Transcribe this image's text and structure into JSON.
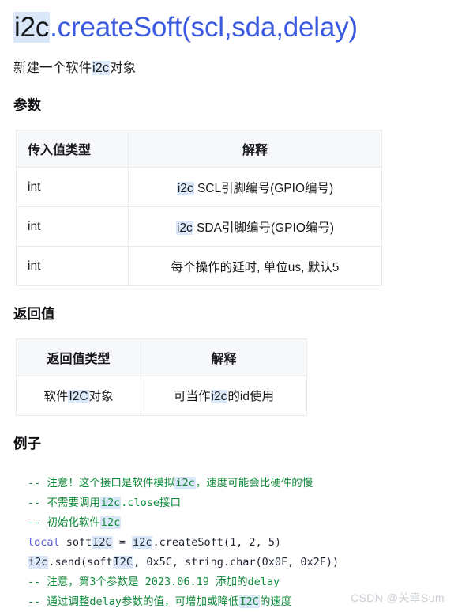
{
  "colors": {
    "title_blue": "#3b5ae0",
    "highlight_bg": "#d9e7f8",
    "table_header_bg": "#f7f8fa",
    "table_border": "#e8eaed",
    "code_comment_green": "#108a3a",
    "code_keyword_purple": "#5b5bd6",
    "watermark_gray": "#c9cdd2",
    "body_text": "#17181a"
  },
  "title": {
    "highlight_token": "i2c",
    "rest": ".createSoft(scl,sda,delay)"
  },
  "subtitle": {
    "before": "新建一个软件",
    "highlight_token": "i2c",
    "after": "对象"
  },
  "sections": {
    "params_heading": "参数",
    "return_heading": "返回值",
    "example_heading": "例子"
  },
  "params_table": {
    "headers": [
      "传入值类型",
      "解释"
    ],
    "rows": [
      {
        "type": "int",
        "desc_before": "",
        "desc_highlight": "i2c",
        "desc_after": " SCL引脚编号(GPIO编号)"
      },
      {
        "type": "int",
        "desc_before": "",
        "desc_highlight": "i2c",
        "desc_after": " SDA引脚编号(GPIO编号)"
      },
      {
        "type": "int",
        "desc_before": "每个操作的延时, 单位us, 默认5",
        "desc_highlight": "",
        "desc_after": ""
      }
    ]
  },
  "return_table": {
    "headers": [
      "返回值类型",
      "解释"
    ],
    "rows": [
      {
        "type_before": "软件",
        "type_highlight": "I2C",
        "type_after": "对象",
        "desc_before": "可当作",
        "desc_highlight": "i2c",
        "desc_after": "的id使用"
      }
    ]
  },
  "code": {
    "language": "lua",
    "lines": [
      [
        {
          "t": "comment",
          "v": "-- 注意！这个接口是软件模拟"
        },
        {
          "t": "comment-hl",
          "v": "i2c"
        },
        {
          "t": "comment",
          "v": "，速度可能会比硬件的慢"
        }
      ],
      [
        {
          "t": "comment",
          "v": "-- 不需要调用"
        },
        {
          "t": "comment-hl",
          "v": "i2c"
        },
        {
          "t": "comment",
          "v": ".close接口"
        }
      ],
      [
        {
          "t": "comment",
          "v": "-- 初始化软件"
        },
        {
          "t": "comment-hl",
          "v": "i2c"
        }
      ],
      [
        {
          "t": "keyword",
          "v": "local"
        },
        {
          "t": "plain",
          "v": " soft"
        },
        {
          "t": "plain-hl",
          "v": "I2C"
        },
        {
          "t": "plain",
          "v": " = "
        },
        {
          "t": "plain-hl",
          "v": "i2c"
        },
        {
          "t": "plain",
          "v": ".createSoft(1, 2, 5)"
        }
      ],
      [
        {
          "t": "plain-hl",
          "v": "i2c"
        },
        {
          "t": "plain",
          "v": ".send(soft"
        },
        {
          "t": "plain-hl",
          "v": "I2C"
        },
        {
          "t": "plain",
          "v": ", 0x5C, string.char(0x0F, 0x2F))"
        }
      ],
      [
        {
          "t": "comment",
          "v": "-- 注意，第3个参数是 2023.06.19 添加的delay"
        }
      ],
      [
        {
          "t": "comment",
          "v": "-- 通过调整delay参数的值，可增加或降低"
        },
        {
          "t": "comment-hl",
          "v": "I2C"
        },
        {
          "t": "comment",
          "v": "的速度"
        }
      ]
    ]
  },
  "watermark": {
    "text": "CSDN @关聿Sum"
  }
}
